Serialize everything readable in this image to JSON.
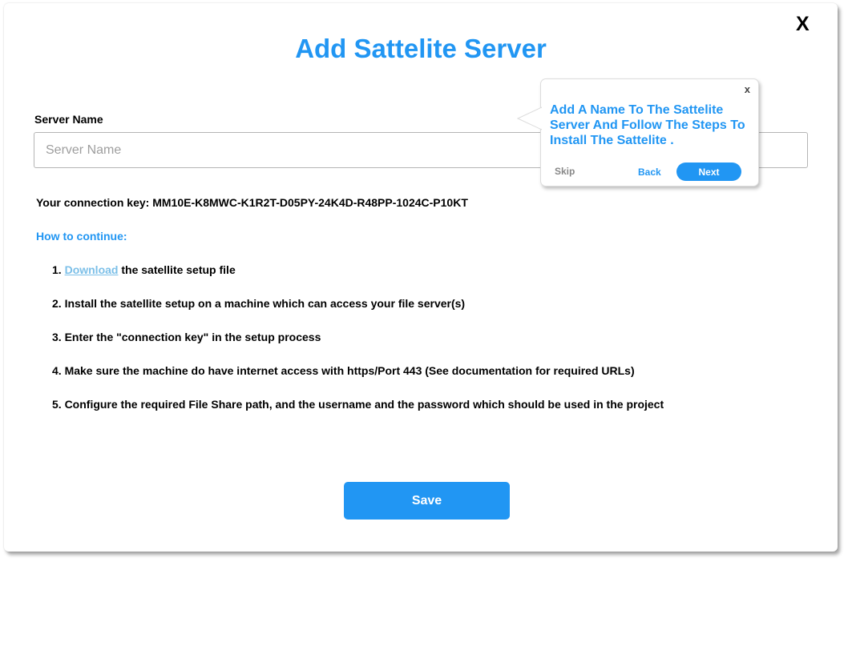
{
  "modal": {
    "close_label": "X",
    "title": "Add Sattelite Server"
  },
  "server_name": {
    "label": "Server Name",
    "placeholder": "Server Name",
    "value": ""
  },
  "connection_key": {
    "text": "Your connection key: MM10E-K8MWC-K1R2T-D05PY-24K4D-R48PP-1024C-P10KT"
  },
  "instructions": {
    "heading": "How to continue:",
    "step1_prefix": "1. ",
    "step1_link": "Download",
    "step1_suffix": " the satellite setup file",
    "step2": "2. Install the satellite setup on a machine which can access your file server(s)",
    "step3": "3. Enter the \"connection key\" in the setup process",
    "step4": "4. Make sure the machine do have internet access with https/Port 443 (See documentation for required URLs)",
    "step5": "5. Configure the required File Share path, and the username and the password which should be used in the project"
  },
  "save_label": "Save",
  "tooltip": {
    "close_label": "x",
    "message": "Add A Name To The Sattelite Server And Follow The Steps To Install The Sattelite .",
    "skip_label": "Skip",
    "back_label": "Back",
    "next_label": "Next"
  },
  "colors": {
    "accent": "#2196f3",
    "link": "#7bbfe8",
    "text": "#000000"
  }
}
